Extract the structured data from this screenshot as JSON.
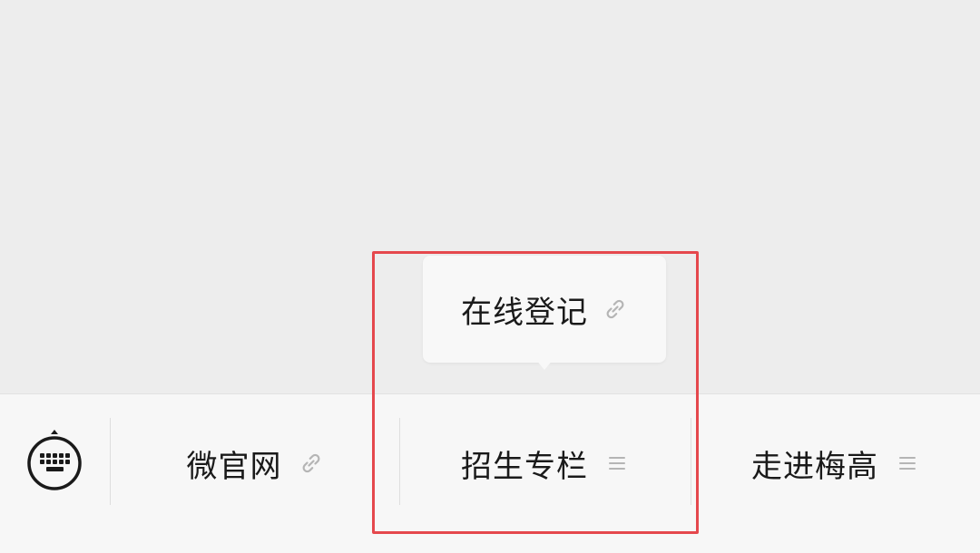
{
  "menu": {
    "items": [
      {
        "label": "微官网",
        "icon": "link-icon"
      },
      {
        "label": "招生专栏",
        "icon": "menu-lines-icon"
      },
      {
        "label": "走进梅高",
        "icon": "menu-lines-icon"
      }
    ]
  },
  "submenu": {
    "items": [
      {
        "label": "在线登记",
        "icon": "link-icon"
      }
    ]
  },
  "colors": {
    "background": "#ededed",
    "menu_bar": "#f7f7f7",
    "highlight": "#e5484d",
    "text": "#1a1a1a",
    "icon": "#b5b5b5"
  }
}
